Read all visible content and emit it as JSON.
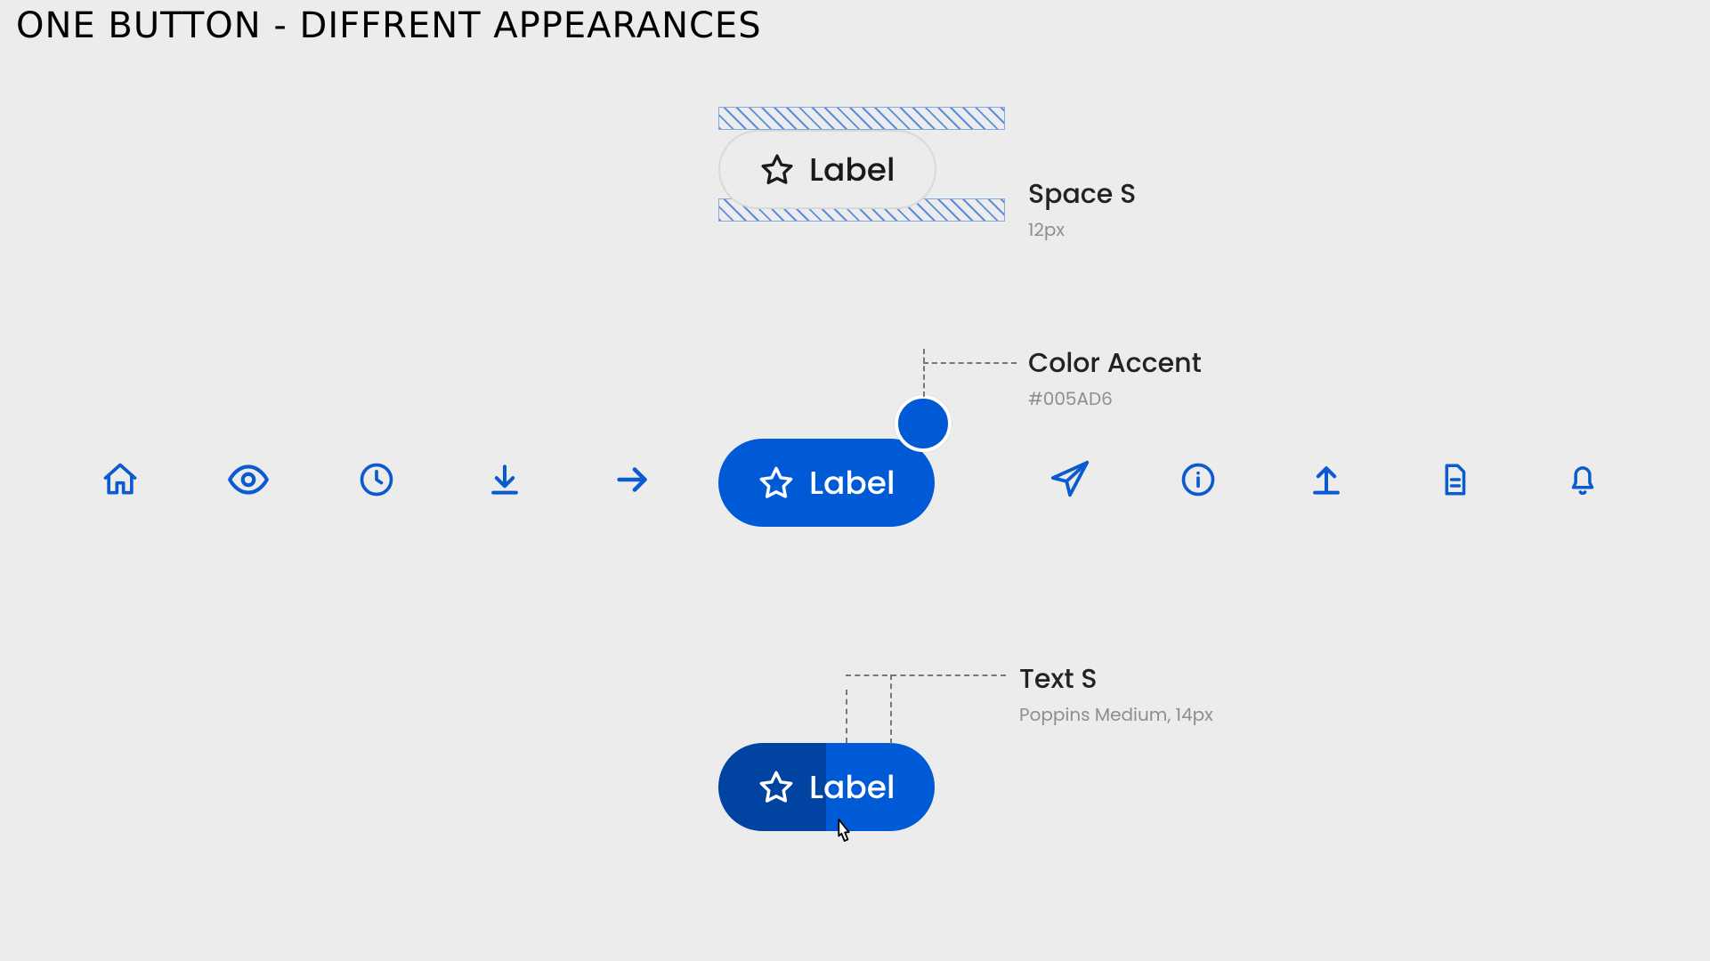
{
  "title": "ONE BUTTON - DIFFRENT APPEARANCES",
  "button_label": "Label",
  "accent_color": "#005AD6",
  "annotations": {
    "space": {
      "title": "Space S",
      "sub": "12px"
    },
    "color": {
      "title": "Color Accent",
      "sub": "#005AD6"
    },
    "text": {
      "title": "Text S",
      "sub": "Poppins Medium, 14px"
    }
  },
  "icons_left": [
    "home",
    "eye",
    "clock",
    "download",
    "arrow-right"
  ],
  "icons_right": [
    "paper-plane",
    "info",
    "upload",
    "document",
    "bell"
  ]
}
